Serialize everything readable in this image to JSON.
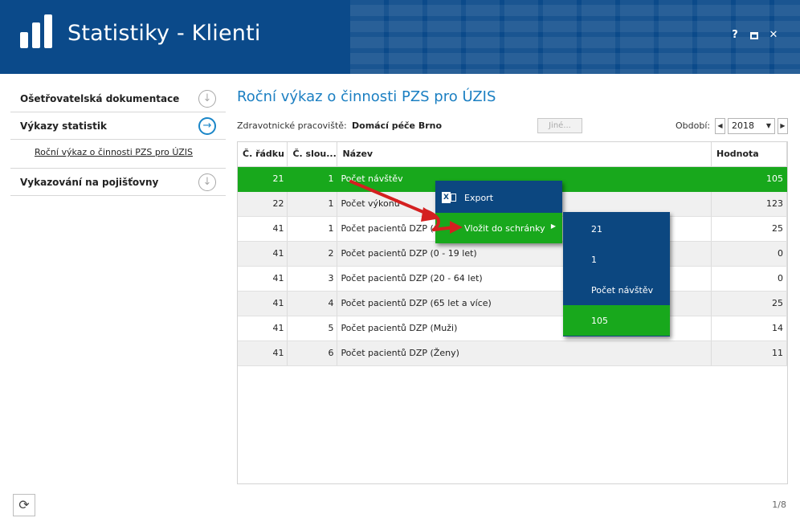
{
  "window": {
    "title": "Statistiky - Klienti",
    "help_label": "?",
    "close_label": "✕"
  },
  "sidebar": {
    "items": [
      {
        "label": "Ošetřovatelská dokumentace",
        "icon": "arrow-down-circle-icon"
      },
      {
        "label": "Výkazy statistik",
        "icon": "arrow-right-circle-icon"
      },
      {
        "label": "Vykazování na pojišťovny",
        "icon": "arrow-down-circle-icon"
      }
    ],
    "sub_items": [
      {
        "label": "Roční výkaz o činnosti PZS pro ÚZIS"
      }
    ]
  },
  "main": {
    "title": "Roční výkaz o činnosti PZS pro ÚZIS",
    "filter": {
      "workplace_label": "Zdravotnické pracoviště:",
      "workplace_value": "Domácí péče Brno",
      "other_button": "Jiné...",
      "period_label": "Období:",
      "year": "2018"
    },
    "table": {
      "columns": [
        "Č. řádku",
        "Č. slou...",
        "Název",
        "Hodnota"
      ],
      "rows": [
        {
          "row": "21",
          "col": "1",
          "name": "Počet návštěv",
          "value": "105",
          "selected": true
        },
        {
          "row": "22",
          "col": "1",
          "name": "Počet výkonů",
          "value": "123"
        },
        {
          "row": "41",
          "col": "1",
          "name": "Počet pacientů DZP (C",
          "value": "25"
        },
        {
          "row": "41",
          "col": "2",
          "name": "Počet pacientů DZP (0 - 19 let)",
          "value": "0"
        },
        {
          "row": "41",
          "col": "3",
          "name": "Počet pacientů DZP (20 - 64 let)",
          "value": "0"
        },
        {
          "row": "41",
          "col": "4",
          "name": "Počet pacientů DZP (65 let a více)",
          "value": "25"
        },
        {
          "row": "41",
          "col": "5",
          "name": "Počet pacientů DZP (Muži)",
          "value": "14"
        },
        {
          "row": "41",
          "col": "6",
          "name": "Počet pacientů DZP (Ženy)",
          "value": "11"
        }
      ]
    }
  },
  "context_menu": {
    "items": [
      {
        "label": "Export",
        "icon": "excel-icon"
      },
      {
        "label": "Vložit do schránky",
        "icon": "submenu-arrow-icon"
      }
    ],
    "submenu": [
      "21",
      "1",
      "Počet návštěv",
      "105"
    ]
  },
  "footer": {
    "refresh_icon": "refresh-icon",
    "page": "1/8"
  },
  "colors": {
    "header": "#0b4a8a",
    "accent": "#1b7fc2",
    "selection": "#18a81c",
    "menu": "#0c4780",
    "annotation": "#d42020"
  }
}
